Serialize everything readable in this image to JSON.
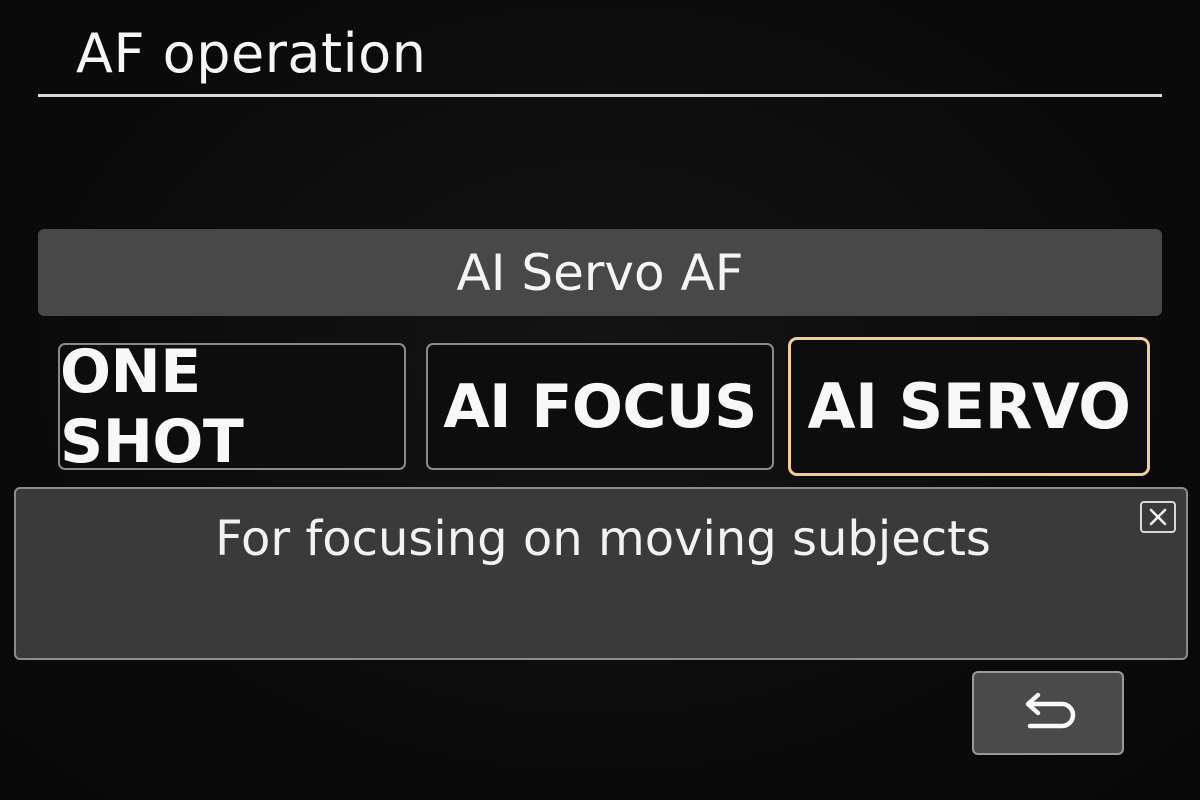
{
  "screen": {
    "title": "AF operation",
    "current_mode_label": "AI Servo AF",
    "options": [
      {
        "label": "ONE SHOT",
        "selected": false
      },
      {
        "label": "AI FOCUS",
        "selected": false
      },
      {
        "label": "AI SERVO",
        "selected": true
      }
    ],
    "description": "For focusing on moving subjects",
    "close_icon": "close-icon",
    "back_icon": "return-arrow-icon"
  },
  "colors": {
    "background": "#0a0a0a",
    "highlight_border": "#f2cf8e",
    "panel": "#484848",
    "description_panel": "#3a3a3a"
  }
}
